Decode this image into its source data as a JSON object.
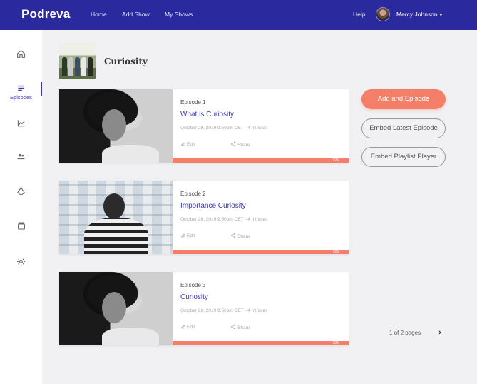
{
  "app": {
    "logo_text": "Podreva"
  },
  "topnav": {
    "links": [
      "Home",
      "Add Show",
      "My Shows"
    ],
    "help": "Help",
    "user_name": "Mercy Johnson",
    "caret": "▾"
  },
  "sidebar": {
    "items": [
      {
        "icon": "home-icon",
        "label": ""
      },
      {
        "icon": "episodes-icon",
        "label": "Episodes",
        "active": true
      },
      {
        "icon": "analytics-icon",
        "label": ""
      },
      {
        "icon": "users-icon",
        "label": ""
      },
      {
        "icon": "recycle-icon",
        "label": ""
      },
      {
        "icon": "archive-icon",
        "label": ""
      },
      {
        "icon": "settings-icon",
        "label": ""
      }
    ]
  },
  "show": {
    "title": "Curiosity"
  },
  "episodes": [
    {
      "number": "Episode 1",
      "title": "What is Curiosity",
      "meta": "October 29, 2019 9:50pm CET - 4 minutes",
      "edit": "Edit",
      "share": "Share",
      "count": "326"
    },
    {
      "number": "Episode  2",
      "title": "Importance Curiosity",
      "meta": "October 29, 2019 9:50pm CET - 4 minutes",
      "edit": "Edit",
      "share": "Share",
      "count": "326"
    },
    {
      "number": "Episode 3",
      "title": "Curiosity",
      "meta": "October 29, 2019 9:50pm CET - 4 minutes",
      "edit": "Edit",
      "share": "Share",
      "count": "326"
    }
  ],
  "actions": {
    "add_episode": "Add and Episode",
    "embed_latest": "Embed Latest Episode",
    "embed_playlist": "Embed Playlist Player"
  },
  "pagination": {
    "text": "1 of 2 pages",
    "next": "›"
  },
  "colors": {
    "nav": "#2a2a9e",
    "accent": "#f47e67",
    "link": "#3a3ab0"
  }
}
